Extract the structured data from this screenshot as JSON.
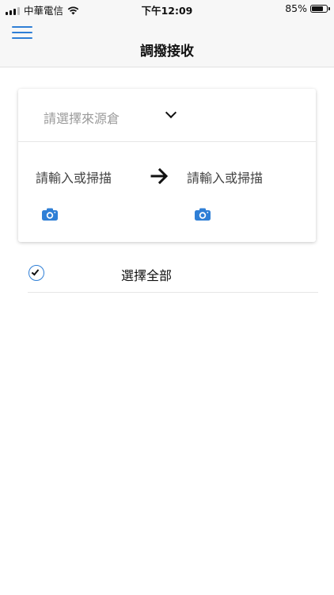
{
  "status_bar": {
    "carrier": "中華電信",
    "time": "下午12:09",
    "battery_percent_label": "85%",
    "battery_level": 0.85,
    "icons": [
      "cellular-signal-icon",
      "wifi-icon",
      "battery-icon"
    ]
  },
  "nav": {
    "title": "調撥接收",
    "menu_icon": "hamburger-menu-icon"
  },
  "card": {
    "source_placeholder": "請選擇來源倉",
    "source_icon": "chevron-down-icon",
    "from_field_placeholder": "請輸入或掃描",
    "to_field_placeholder": "請輸入或掃描",
    "arrow_icon": "arrow-right-icon",
    "scan_icon": "camera-icon"
  },
  "select_all": {
    "label": "選擇全部",
    "icon": "check-circle-icon"
  },
  "colors": {
    "accent": "#2f7fd6",
    "bar_background": "#f7f7f7",
    "placeholder": "#9a9a9a",
    "text": "#111111"
  }
}
